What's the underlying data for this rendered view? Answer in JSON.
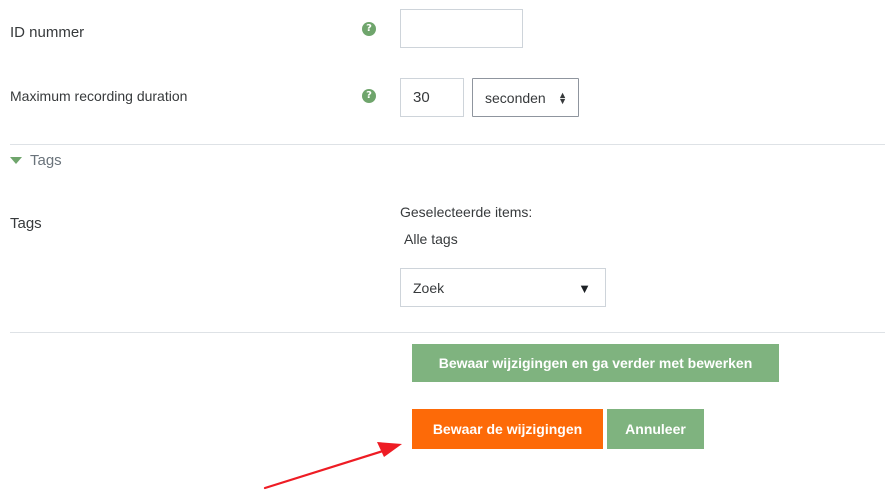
{
  "fields": {
    "id_number": {
      "label": "ID nummer",
      "value": ""
    },
    "max_duration": {
      "label": "Maximum recording duration",
      "value": "30",
      "unit_selected": "seconden"
    }
  },
  "help_icon_glyph": "?",
  "tags_section": {
    "header": "Tags",
    "label": "Tags",
    "selected_items_label": "Geselecteerde items:",
    "selected_items_value": "Alle tags",
    "search_placeholder": "Zoek"
  },
  "buttons": {
    "save_and_continue": "Bewaar wijzigingen en ga verder met bewerken",
    "save": "Bewaar de wijzigingen",
    "cancel": "Annuleer"
  },
  "colors": {
    "accent_green": "#7fb37f",
    "save_orange": "#fd6a08",
    "help_green": "#6fa56c",
    "annotation_arrow": "#ee1c24"
  },
  "icons": {
    "help": "help-icon",
    "section_toggle": "caret-down-icon",
    "select_arrows": "sort-arrows-icon",
    "combo_dropdown": "triangle-down-icon",
    "annotation": "red-arrow-annotation"
  }
}
